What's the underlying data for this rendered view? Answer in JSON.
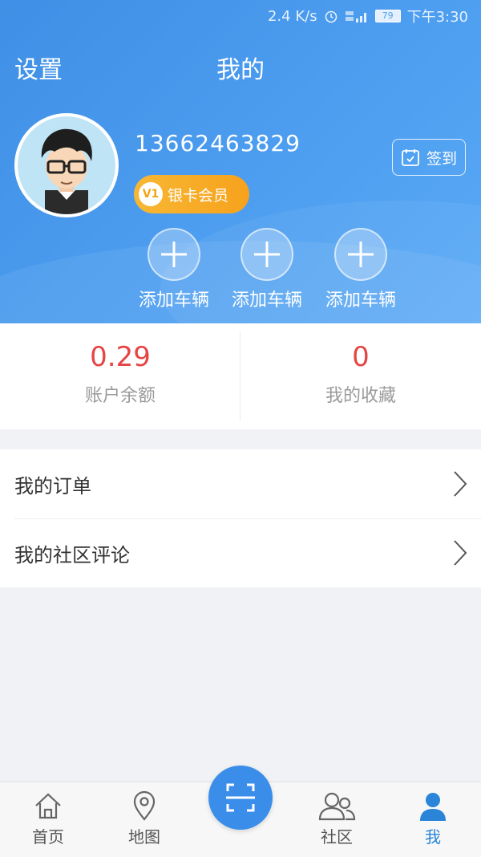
{
  "status_bar": {
    "speed": "2.4 K/s",
    "battery": "79",
    "time": "下午3:30"
  },
  "header": {
    "settings_label": "设置",
    "title": "我的"
  },
  "profile": {
    "phone": "13662463829",
    "member_badge": "银卡会员",
    "level": "V1",
    "checkin_label": "签到"
  },
  "vehicles": [
    {
      "label": "添加车辆"
    },
    {
      "label": "添加车辆"
    },
    {
      "label": "添加车辆"
    }
  ],
  "stats": {
    "balance": {
      "value": "0.29",
      "label": "账户余额"
    },
    "favorites": {
      "value": "0",
      "label": "我的收藏"
    }
  },
  "menu": [
    {
      "label": "我的订单"
    },
    {
      "label": "我的社区评论"
    }
  ],
  "tabs": [
    {
      "label": "首页",
      "icon": "home-icon"
    },
    {
      "label": "地图",
      "icon": "map-pin-icon"
    },
    {
      "label": "",
      "icon": "scan-icon"
    },
    {
      "label": "社区",
      "icon": "community-icon"
    },
    {
      "label": "我",
      "icon": "person-icon"
    }
  ],
  "colors": {
    "header_blue": "#4d9ef0",
    "accent_red": "#e54545",
    "active_tab": "#2a85d8",
    "badge_gold": "#f7b733"
  }
}
